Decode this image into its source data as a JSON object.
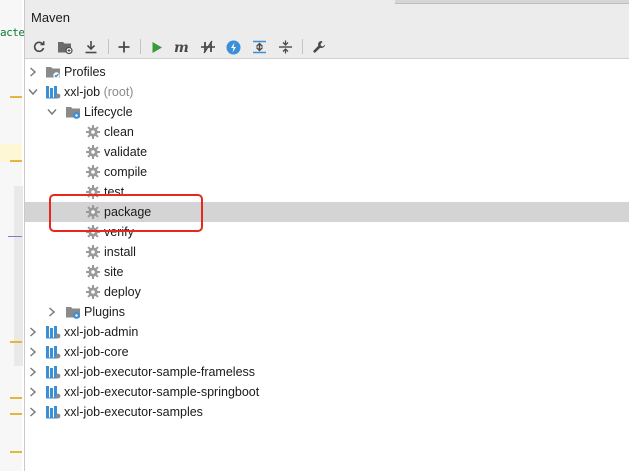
{
  "editor": {
    "code_fragment": "acte"
  },
  "panel": {
    "title": "Maven"
  },
  "toolbar": {
    "buttons": [
      {
        "name": "reimport-icon"
      },
      {
        "name": "generate-sources-icon"
      },
      {
        "name": "download-icon"
      },
      {
        "name": "add-icon"
      },
      {
        "name": "run-icon"
      },
      {
        "name": "execute-goal-icon"
      },
      {
        "name": "toggle-offline-icon"
      },
      {
        "name": "skip-tests-icon"
      },
      {
        "name": "show-dependencies-icon"
      },
      {
        "name": "collapse-all-icon"
      },
      {
        "name": "settings-icon"
      }
    ]
  },
  "tree": {
    "profiles": "Profiles",
    "root": {
      "label": "xxl-job",
      "suffix": "(root)"
    },
    "lifecycle": "Lifecycle",
    "phases": [
      "clean",
      "validate",
      "compile",
      "test",
      "package",
      "verify",
      "install",
      "site",
      "deploy"
    ],
    "selected_phase": "package",
    "plugins": "Plugins",
    "modules": [
      "xxl-job-admin",
      "xxl-job-core",
      "xxl-job-executor-sample-frameless",
      "xxl-job-executor-sample-springboot",
      "xxl-job-executor-samples"
    ]
  },
  "colors": {
    "highlight": "#e8271d",
    "selected_row": "#d4d4d4",
    "run_green": "#3a9a3a",
    "accent_blue": "#3b8fd6"
  }
}
